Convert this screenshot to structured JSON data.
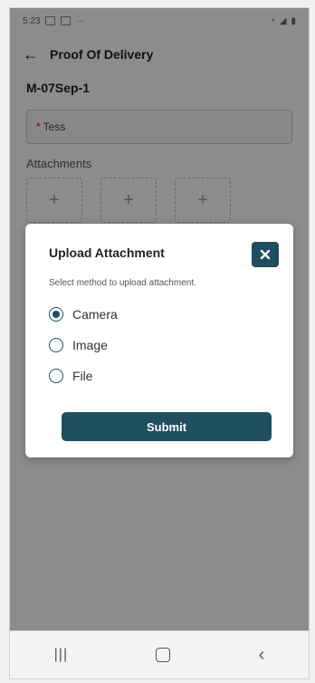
{
  "status": {
    "time": "5:23"
  },
  "header": {
    "title": "Proof Of Delivery"
  },
  "order": {
    "id": "M-07Sep-1"
  },
  "form": {
    "name_value": "Tess",
    "attachments_label": "Attachments"
  },
  "dialog": {
    "title": "Upload Attachment",
    "description": "Select method to upload attachment.",
    "options": [
      {
        "label": "Camera",
        "selected": true
      },
      {
        "label": "Image",
        "selected": false
      },
      {
        "label": "File",
        "selected": false
      }
    ],
    "submit_label": "Submit"
  },
  "colors": {
    "accent": "#1f4e5f"
  },
  "icons": {
    "back": "arrow-left-icon",
    "close": "close-icon"
  }
}
